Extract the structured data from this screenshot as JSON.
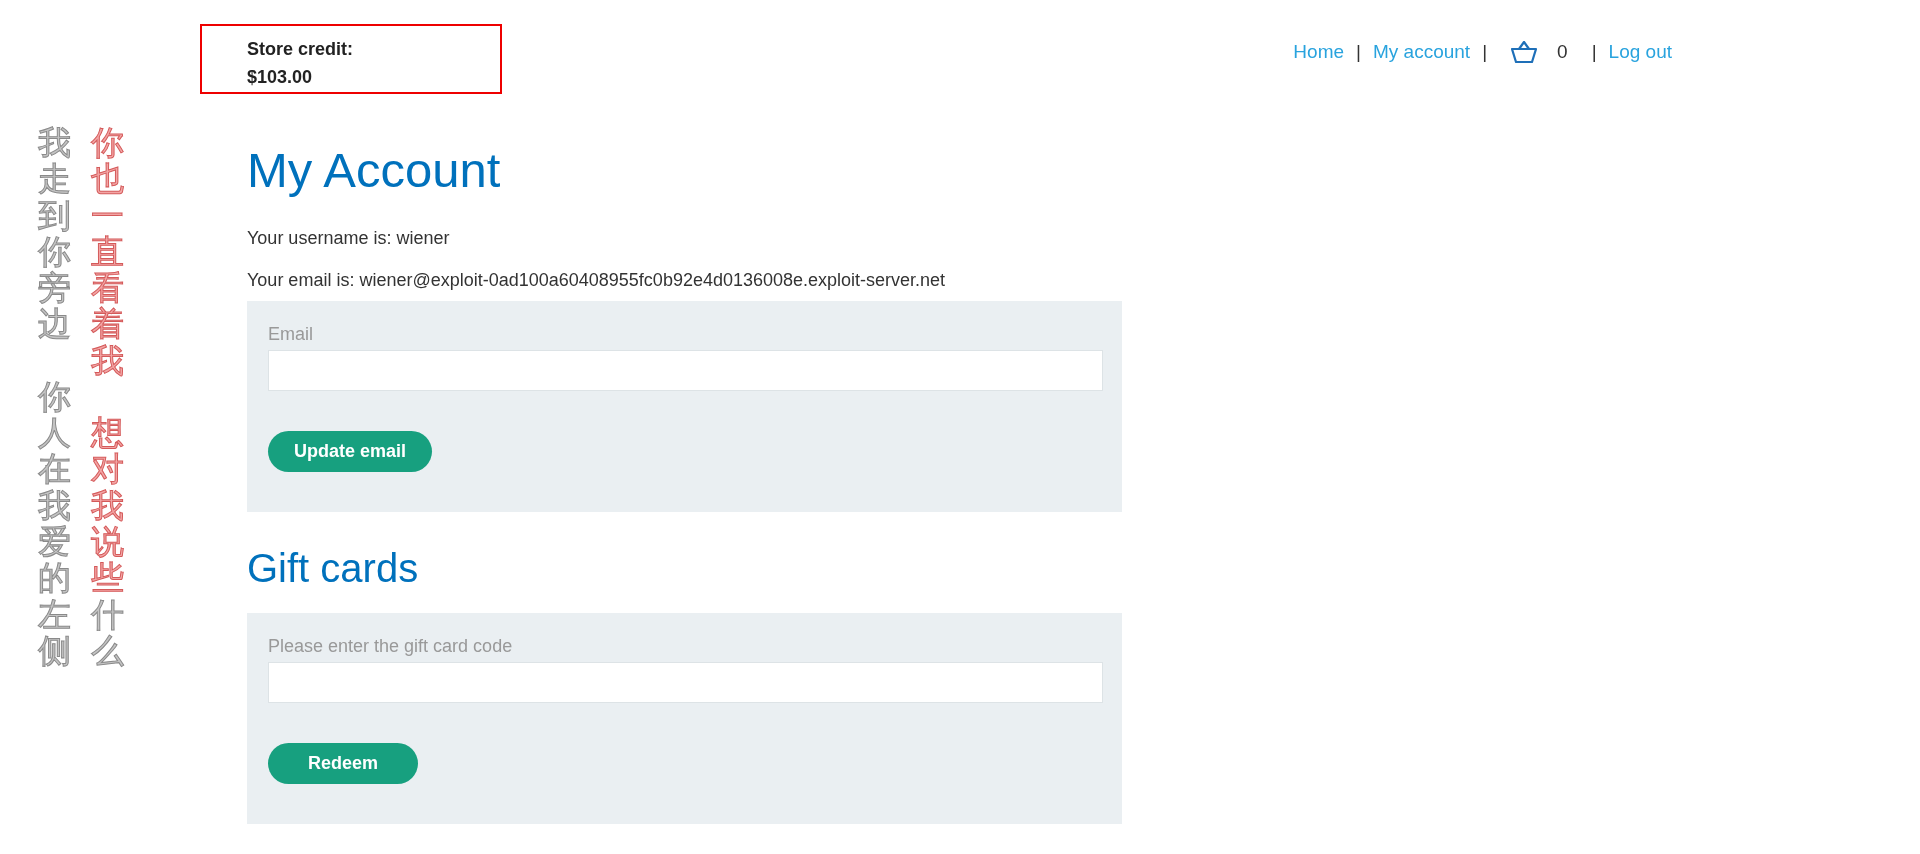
{
  "store_credit": {
    "label": "Store credit:",
    "amount": "$103.00"
  },
  "nav": {
    "items": [
      {
        "kind": "link",
        "text": "Home"
      },
      {
        "kind": "separator",
        "text": "|"
      },
      {
        "kind": "link",
        "text": "My account"
      },
      {
        "kind": "separator",
        "text": "|"
      },
      {
        "kind": "cart",
        "text": "0"
      },
      {
        "kind": "separator",
        "text": "|"
      },
      {
        "kind": "link",
        "text": "Log out"
      }
    ]
  },
  "lyrics": [
    {
      "phrases": [
        {
          "segments": [
            {
              "text": "我走到你旁边",
              "sung": false
            }
          ]
        },
        {
          "segments": [
            {
              "text": "你人在我爱的左侧",
              "sung": false
            }
          ]
        }
      ]
    },
    {
      "phrases": [
        {
          "segments": [
            {
              "text": "你也一直看着我",
              "sung": true
            }
          ]
        },
        {
          "segments": [
            {
              "text": "想对我说些",
              "sung": true
            },
            {
              "text": "什么",
              "sung": false
            }
          ]
        }
      ]
    }
  ],
  "heading": "My Account",
  "info": [
    "Your username is: wiener",
    "Your email is: wiener@exploit-0ad100a60408955fc0b92e4d0136008e.exploit-server.net"
  ],
  "forms": [
    {
      "label": "Email",
      "button": "Update email"
    }
  ],
  "gift_heading": "Gift cards",
  "gift_form": {
    "label": "Please enter the gift card code",
    "button": "Redeem"
  }
}
